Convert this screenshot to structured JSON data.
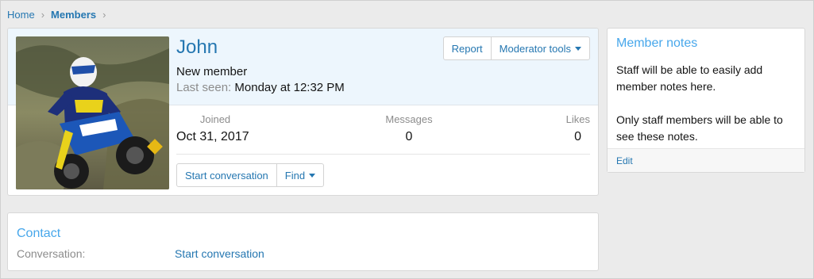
{
  "breadcrumb": {
    "home": "Home",
    "current": "Members",
    "separator": "›"
  },
  "profile": {
    "username": "John",
    "user_title": "New member",
    "last_seen_label": "Last seen:",
    "last_seen_value": "Monday at 12:32 PM",
    "report_label": "Report",
    "moderator_tools_label": "Moderator tools",
    "stats": {
      "joined_label": "Joined",
      "joined_value": "Oct 31, 2017",
      "messages_label": "Messages",
      "messages_value": "0",
      "likes_label": "Likes",
      "likes_value": "0"
    },
    "start_conversation_label": "Start conversation",
    "find_label": "Find"
  },
  "contact": {
    "title": "Contact",
    "conversation_label": "Conversation:",
    "conversation_link": "Start conversation"
  },
  "notes": {
    "title": "Member notes",
    "paragraph1": "Staff will be able to easily add member notes here.",
    "paragraph2": "Only staff members will be able to see these notes.",
    "edit_label": "Edit"
  },
  "colors": {
    "link": "#2577b1",
    "heading_accent": "#47a7eb",
    "header_bg": "#edf6fd",
    "page_bg": "#ebebeb"
  }
}
